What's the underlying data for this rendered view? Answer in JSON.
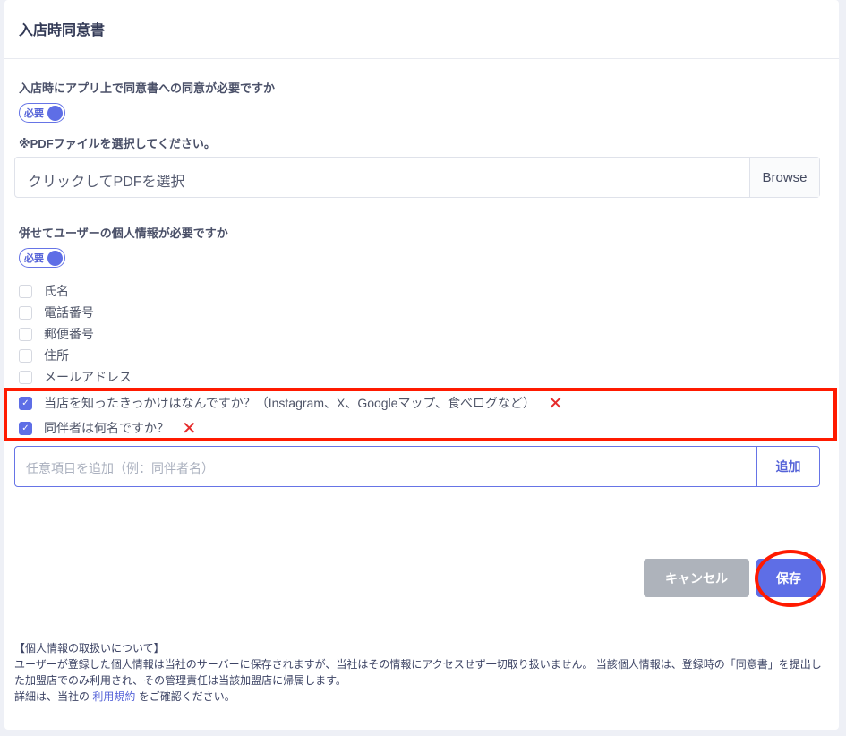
{
  "header": {
    "title": "入店時同意書"
  },
  "consent": {
    "question": "入店時にアプリ上で同意書への同意が必要ですか",
    "toggle_label": "必要",
    "toggle_on": true
  },
  "pdf": {
    "label": "※PDFファイルを選択してください。",
    "placeholder": "クリックしてPDFを選択",
    "browse": "Browse"
  },
  "personal": {
    "question": "併せてユーザーの個人情報が必要ですか",
    "toggle_label": "必要",
    "toggle_on": true,
    "fields": [
      {
        "label": "氏名",
        "checked": false
      },
      {
        "label": "電話番号",
        "checked": false
      },
      {
        "label": "郵便番号",
        "checked": false
      },
      {
        "label": "住所",
        "checked": false
      },
      {
        "label": "メールアドレス",
        "checked": false
      }
    ],
    "custom": [
      {
        "label": "当店を知ったきっかけはなんですか？（Instagram、X、Googleマップ、食べログなど）",
        "checked": true,
        "remove_icon": "close-icon"
      },
      {
        "label": "同伴者は何名ですか？",
        "checked": true,
        "remove_icon": "close-icon"
      }
    ]
  },
  "add_item": {
    "placeholder": "任意項目を追加（例：同伴者名）",
    "button": "追加"
  },
  "actions": {
    "cancel": "キャンセル",
    "save": "保存"
  },
  "notice": {
    "title": "【個人情報の取扱いについて】",
    "body": "ユーザーが登録した個人情報は当社のサーバーに保存されますが、当社はその情報にアクセスせず一切取り扱いません。 当該個人情報は、登録時の「同意書」を提出した加盟店でのみ利用され、その管理責任は当該加盟店に帰属します。",
    "detail_prefix": "詳細は、当社の",
    "link": "利用規約",
    "detail_suffix": "をご確認ください。"
  }
}
